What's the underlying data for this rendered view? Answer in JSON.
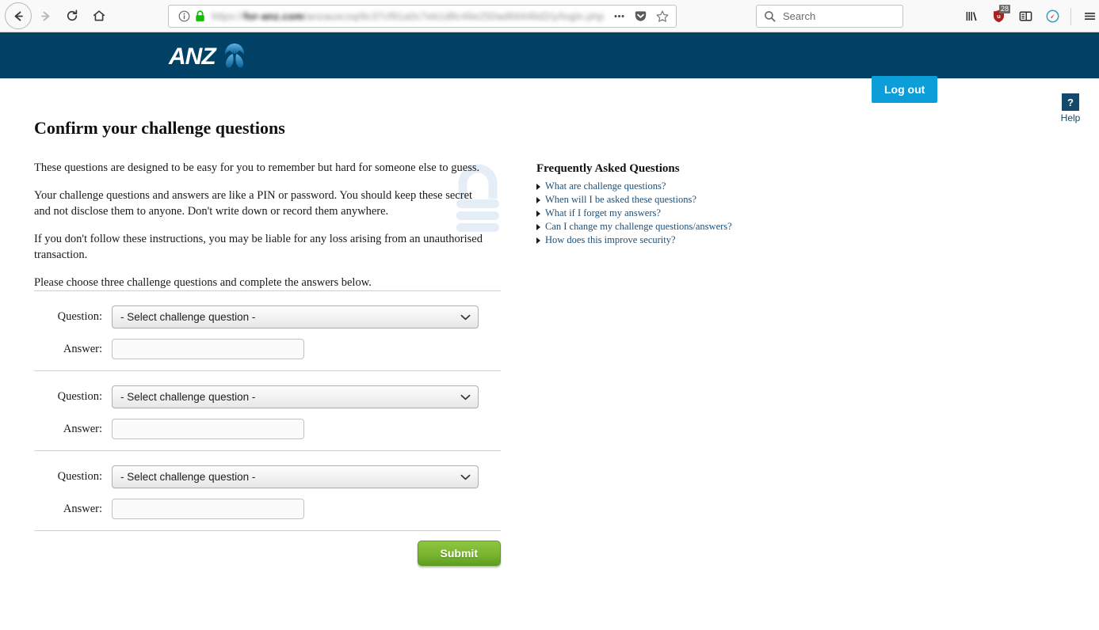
{
  "browser": {
    "nav": {
      "back": "back-arrow",
      "forward": "forward-arrow",
      "reload": "reload",
      "home": "home"
    },
    "urlbar": {
      "identity_icon": "info-circle-icon",
      "lock_icon": "padlock-icon-green",
      "url_prefix": "https://",
      "url_domain": "for-anz.com",
      "url_rest": "/anzauscsq/6c37cf91a0c7eb1d8c46e250ad69446d2/y/login.php",
      "page_actions_icon": "ellipsis-icon",
      "pocket_icon": "pocket-icon",
      "bookmark_icon": "star-icon"
    },
    "search": {
      "placeholder": "Search",
      "icon": "magnifier-icon"
    },
    "toolbar_icons": [
      {
        "name": "library-icon",
        "badge": ""
      },
      {
        "name": "ublock-origin-icon",
        "badge": "28"
      },
      {
        "name": "reader-sidebar-icon",
        "badge": ""
      },
      {
        "name": "speedometer-icon",
        "badge": ""
      },
      {
        "name": "hamburger-menu-icon",
        "badge": ""
      }
    ]
  },
  "site_header": {
    "brand": "ANZ",
    "logo_icon": "anz-lotus-icon",
    "logout_label": "Log out",
    "bg_color": "#004165",
    "logout_color": "#0c9ed9"
  },
  "help": {
    "icon_glyph": "?",
    "label": "Help",
    "color": "#14496b"
  },
  "page": {
    "title": "Confirm your challenge questions",
    "paragraphs": [
      "These questions are designed to be easy for you to remember but hard for someone else to guess.",
      "Your challenge questions and answers are like a PIN or password. You should keep these secret and not disclose them to anyone. Don't write down or record them anywhere.",
      "If you don't follow these instructions, you may be liable for any loss arising from an unauthorised transaction.",
      "Please choose three challenge questions and complete the answers below."
    ],
    "watermark_icon": "padlock-watermark-icon"
  },
  "faq": {
    "title": "Frequently Asked Questions",
    "link_color": "#1c4f78",
    "items": [
      "What are challenge questions?",
      "When will I be asked these questions?",
      "What if I forget my answers?",
      "Can I change my challenge questions/answers?",
      "How does this improve security?"
    ]
  },
  "form": {
    "question_label": "Question:",
    "answer_label": "Answer:",
    "select_placeholder": "- Select challenge question -",
    "select_chevron_icon": "chevron-down-icon",
    "answer_value": "",
    "answer_placeholder": "",
    "blocks": [
      {
        "question_value": "- Select challenge question -",
        "answer_value": ""
      },
      {
        "question_value": "- Select challenge question -",
        "answer_value": ""
      },
      {
        "question_value": "- Select challenge question -",
        "answer_value": ""
      }
    ],
    "submit_label": "Submit",
    "submit_color": "#7ab52f"
  }
}
